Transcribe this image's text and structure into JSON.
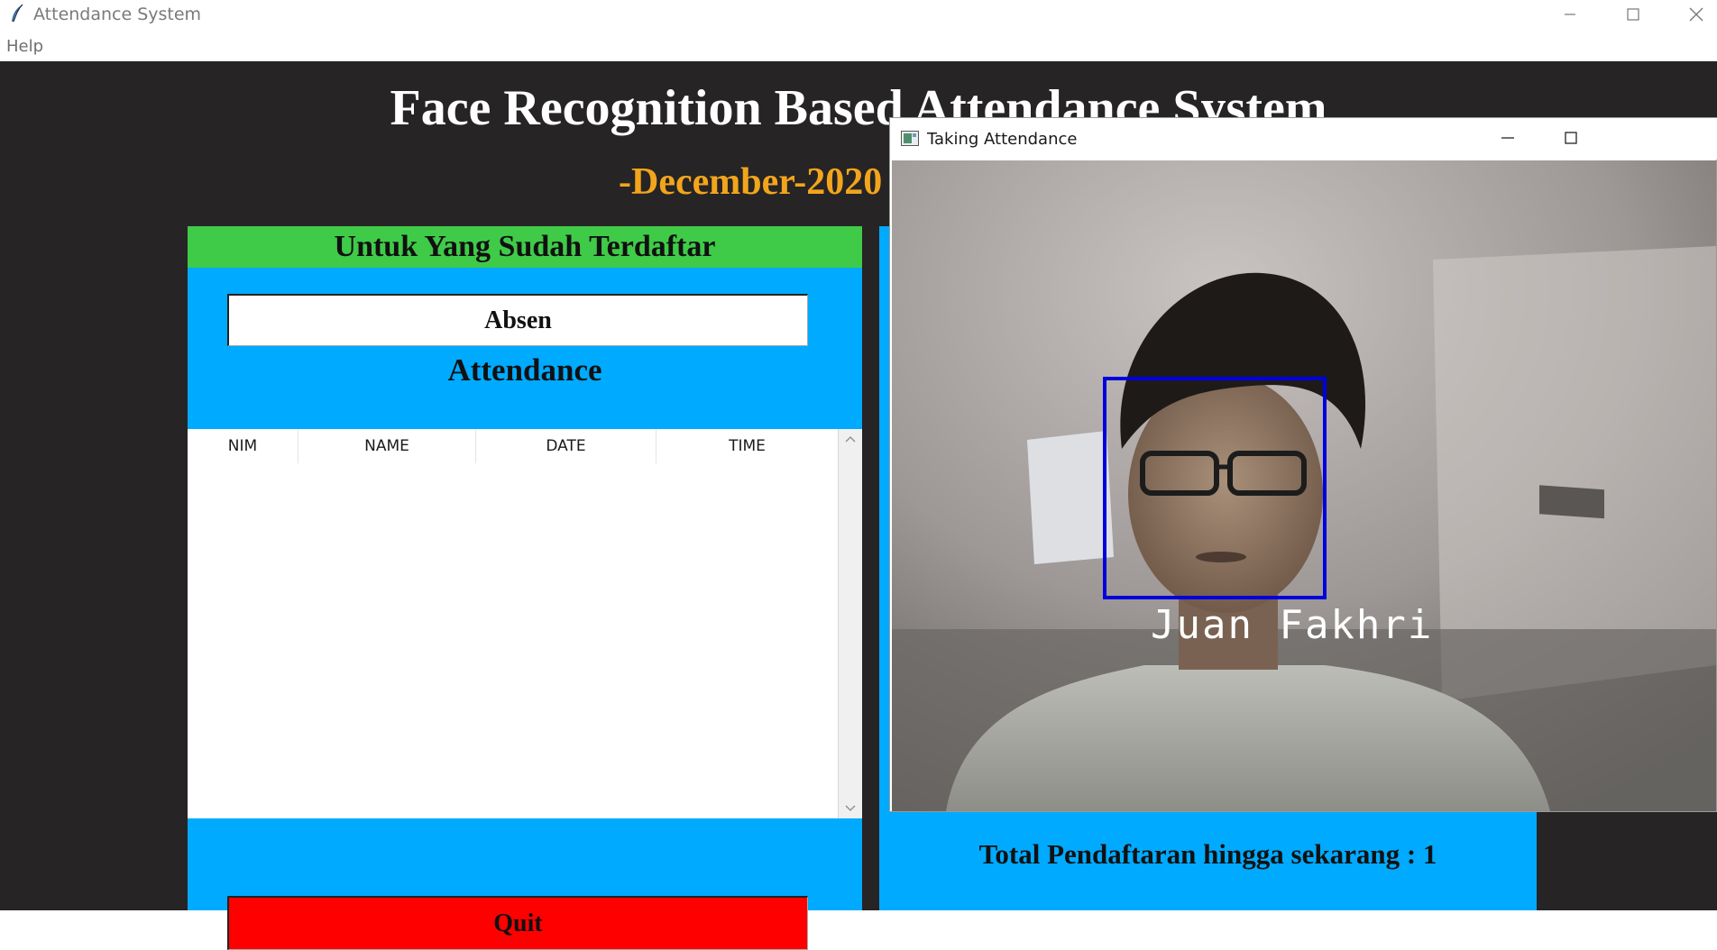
{
  "window": {
    "title": "Attendance System",
    "controls": [
      "minimize-icon",
      "maximize-icon",
      "close-icon"
    ]
  },
  "menu": {
    "items": [
      "Help"
    ]
  },
  "main": {
    "heading": "Face Recognition Based Attendance System",
    "date": "-December-2020",
    "colors": {
      "background": "#262424",
      "panel": "#00aaff",
      "header": "#3fcb48",
      "date": "#f2a51c",
      "quit": "#ff0000"
    }
  },
  "registered_panel": {
    "header": "Untuk Yang Sudah Terdaftar",
    "absen_button": "Absen",
    "attendance_label": "Attendance",
    "table": {
      "columns": [
        "NIM",
        "NAME",
        "DATE",
        "TIME"
      ],
      "rows": []
    },
    "quit_button": "Quit"
  },
  "registration_panel": {
    "total_label": "Total Pendaftaran hingga sekarang  : 1"
  },
  "camera_window": {
    "title": "Taking Attendance",
    "recognized_name": "Juan Fakhri",
    "box_color": "#0000dd"
  }
}
